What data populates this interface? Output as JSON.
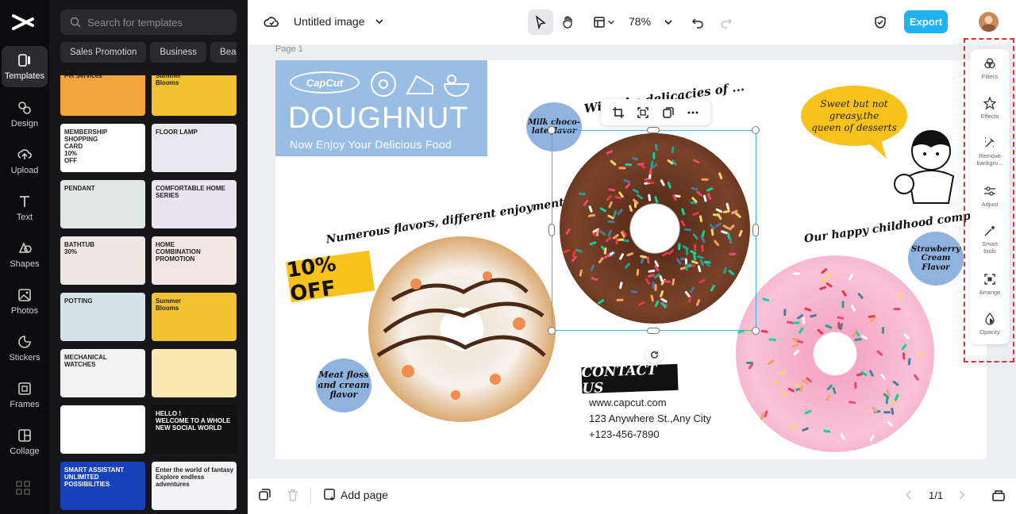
{
  "sidebar": {
    "items": [
      {
        "label": "Templates",
        "icon": "templates-icon"
      },
      {
        "label": "Design",
        "icon": "design-icon"
      },
      {
        "label": "Upload",
        "icon": "upload-icon"
      },
      {
        "label": "Text",
        "icon": "text-icon"
      },
      {
        "label": "Shapes",
        "icon": "shapes-icon"
      },
      {
        "label": "Photos",
        "icon": "photos-icon"
      },
      {
        "label": "Stickers",
        "icon": "stickers-icon"
      },
      {
        "label": "Frames",
        "icon": "frames-icon"
      },
      {
        "label": "Collage",
        "icon": "collage-icon"
      }
    ]
  },
  "templates": {
    "search_placeholder": "Search for templates",
    "categories": [
      "Sales Promotion",
      "Business",
      "Beauty"
    ],
    "thumbnails": [
      {
        "label": "Pet Services",
        "color": "#f3a43b"
      },
      {
        "label": "Summer\nBlooms",
        "color": "#f2c230"
      },
      {
        "label": "MEMBERSHIP\nSHOPPING\nCARD\n10%\nOFF",
        "color": "#ffffff"
      },
      {
        "label": "FLOOR LAMP",
        "color": "#e8e8ee"
      },
      {
        "label": "PENDANT",
        "color": "#dfe6e4"
      },
      {
        "label": "COMFORTABLE HOME\nSERIES",
        "color": "#e9e4f0"
      },
      {
        "label": "BATHTUB\n30%",
        "color": "#ece7e3"
      },
      {
        "label": "HOME\nCOMBINATION\nPROMOTION",
        "color": "#f3e6e2"
      },
      {
        "label": "POTTING",
        "color": "#d6e2ea"
      },
      {
        "label": "Summer\nBlooms",
        "color": "#f2c230"
      },
      {
        "label": "MECHANICAL\nWATCHES",
        "color": "#f2f2f2"
      },
      {
        "label": "",
        "color": "#fbe7b0"
      },
      {
        "label": "",
        "color": "#ffffff"
      },
      {
        "label": "HELLO !\nWELCOME TO A WHOLE\nNEW SOCIAL WORLD",
        "color": "#111111"
      },
      {
        "label": "SMART ASSISTANT\nUNLIMITED\nPOSSIBILITIES",
        "color": "#1741b8"
      },
      {
        "label": "Enter the world of fantasy\nExplore endless adventures",
        "color": "#f4f4f6"
      }
    ]
  },
  "topbar": {
    "title": "Untitled image",
    "zoom": "78%",
    "export_label": "Export"
  },
  "canvas": {
    "page_label": "Page 1",
    "banner_brand": "CapCut",
    "banner_title": "DOUGHNUT",
    "banner_subtitle": "Now Enjoy Your Delicious Food",
    "headline_left": "Numerous flavors, different enjoyment",
    "headline_center": "With the delicacies of ...",
    "headline_right": "Our happy childhood companion",
    "bubble_milk": "Milk choco-\nlate flavor",
    "bubble_meat": "Meat floss\nand cream\nflavor",
    "bubble_strawberry": "Strawberry\nCream Flavor",
    "yellow_quote": "Sweet but not\ngreasy,the\nqueen of desserts",
    "discount": "10% OFF",
    "contact_title": "CONTACT US",
    "contact_web": "www.capcut.com",
    "contact_address": "123 Anywhere St.,Any City",
    "contact_phone": "+123-456-7890"
  },
  "right_tools": [
    {
      "label": "Filters",
      "icon": "filters-icon"
    },
    {
      "label": "Effects",
      "icon": "effects-icon"
    },
    {
      "label": "Remove\nbackgro...",
      "icon": "remove-background-icon"
    },
    {
      "label": "Adjust",
      "icon": "adjust-icon"
    },
    {
      "label": "Smart\ntools",
      "icon": "smart-tools-icon"
    },
    {
      "label": "Arrange",
      "icon": "arrange-icon"
    },
    {
      "label": "Opacity",
      "icon": "opacity-icon"
    }
  ],
  "bottombar": {
    "add_page": "Add page",
    "pager": "1/1"
  },
  "colors": {
    "accent": "#1fb1f2",
    "highlight": "#e3312d",
    "banner": "#99bde3",
    "yellow": "#f7c21b"
  }
}
